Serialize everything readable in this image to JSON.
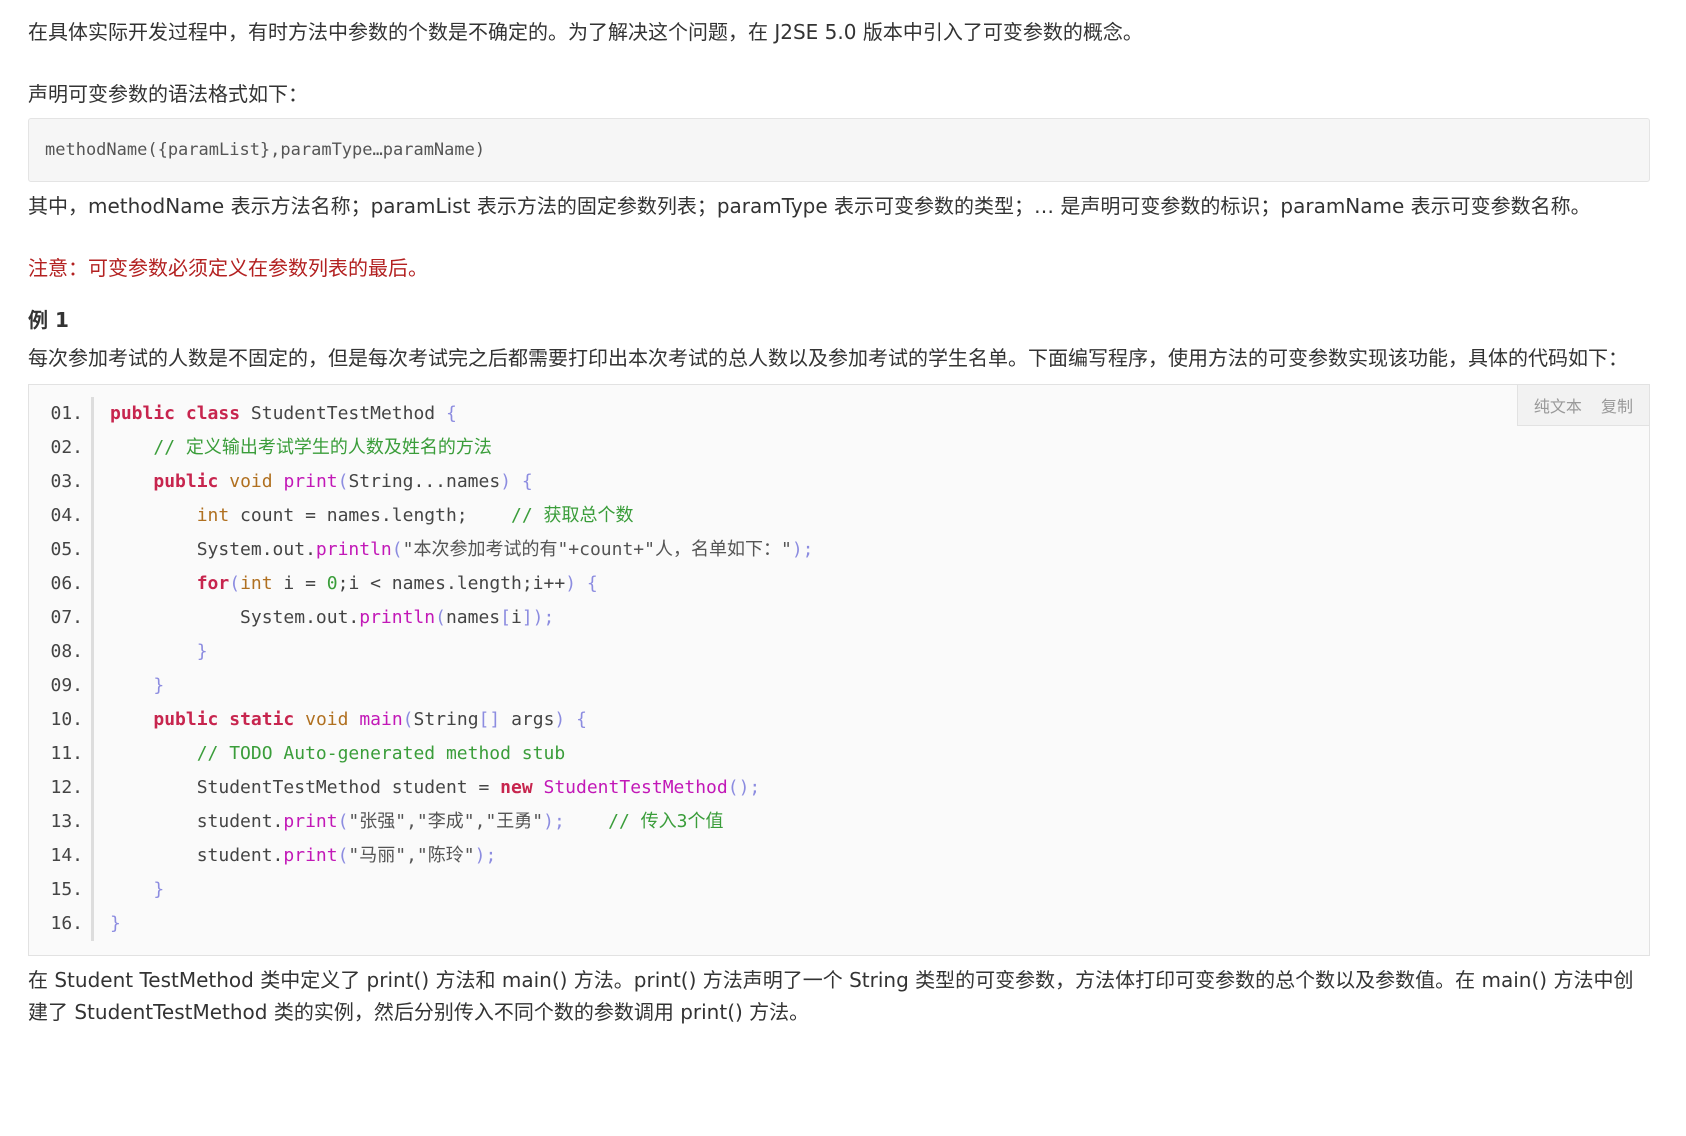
{
  "paragraphs": {
    "intro": "在具体实际开发过程中，有时方法中参数的个数是不确定的。为了解决这个问题，在 J2SE 5.0 版本中引入了可变参数的概念。",
    "syntax_intro": "声明可变参数的语法格式如下：",
    "syntax": "methodName({paramList},paramType…paramName)",
    "explain": "其中，methodName 表示方法名称；paramList 表示方法的固定参数列表；paramType 表示可变参数的类型；… 是声明可变参数的标识；paramName 表示可变参数名称。",
    "note": "注意：可变参数必须定义在参数列表的最后。",
    "example_title": "例 1",
    "example_desc": "每次参加考试的人数是不固定的，但是每次考试完之后都需要打印出本次考试的总人数以及参加考试的学生名单。下面编写程序，使用方法的可变参数实现该功能，具体的代码如下：",
    "summary": "在 Student TestMethod 类中定义了 print() 方法和 main() 方法。print() 方法声明了一个 String 类型的可变参数，方法体打印可变参数的总个数以及参数值。在 main() 方法中创建了 StudentTestMethod 类的实例，然后分别传入不同个数的参数调用 print() 方法。"
  },
  "code_tools": {
    "plain_text": "纯文本",
    "copy": "复制"
  },
  "code": {
    "line_numbers": [
      "01.",
      "02.",
      "03.",
      "04.",
      "05.",
      "06.",
      "07.",
      "08.",
      "09.",
      "10.",
      "11.",
      "12.",
      "13.",
      "14.",
      "15.",
      "16."
    ],
    "lines": [
      [
        {
          "t": "kw",
          "v": "public"
        },
        {
          "t": "",
          "v": " "
        },
        {
          "t": "kw",
          "v": "class"
        },
        {
          "t": "",
          "v": " StudentTestMethod "
        },
        {
          "t": "punc",
          "v": "{"
        }
      ],
      [
        {
          "t": "",
          "v": "    "
        },
        {
          "t": "cm",
          "v": "// 定义输出考试学生的人数及姓名的方法"
        }
      ],
      [
        {
          "t": "",
          "v": "    "
        },
        {
          "t": "kw",
          "v": "public"
        },
        {
          "t": "",
          "v": " "
        },
        {
          "t": "ty",
          "v": "void"
        },
        {
          "t": "",
          "v": " "
        },
        {
          "t": "fn",
          "v": "print"
        },
        {
          "t": "punc",
          "v": "("
        },
        {
          "t": "",
          "v": "String...names"
        },
        {
          "t": "punc",
          "v": ")"
        },
        {
          "t": "",
          "v": " "
        },
        {
          "t": "punc",
          "v": "{"
        }
      ],
      [
        {
          "t": "",
          "v": "        "
        },
        {
          "t": "ty",
          "v": "int"
        },
        {
          "t": "",
          "v": " count = names.length;    "
        },
        {
          "t": "cm",
          "v": "// 获取总个数"
        }
      ],
      [
        {
          "t": "",
          "v": "        System.out."
        },
        {
          "t": "fn",
          "v": "println"
        },
        {
          "t": "punc",
          "v": "("
        },
        {
          "t": "st",
          "v": "\"本次参加考试的有\"+count+\"人，名单如下：\""
        },
        {
          "t": "punc",
          "v": ");"
        }
      ],
      [
        {
          "t": "",
          "v": "        "
        },
        {
          "t": "kw",
          "v": "for"
        },
        {
          "t": "punc",
          "v": "("
        },
        {
          "t": "ty",
          "v": "int"
        },
        {
          "t": "",
          "v": " i = "
        },
        {
          "t": "num",
          "v": "0"
        },
        {
          "t": "",
          "v": ";i < names.length;i++"
        },
        {
          "t": "punc",
          "v": ")"
        },
        {
          "t": "",
          "v": " "
        },
        {
          "t": "punc",
          "v": "{"
        }
      ],
      [
        {
          "t": "",
          "v": "            System.out."
        },
        {
          "t": "fn",
          "v": "println"
        },
        {
          "t": "punc",
          "v": "("
        },
        {
          "t": "",
          "v": "names"
        },
        {
          "t": "punc",
          "v": "["
        },
        {
          "t": "",
          "v": "i"
        },
        {
          "t": "punc",
          "v": "]);"
        }
      ],
      [
        {
          "t": "",
          "v": "        "
        },
        {
          "t": "punc",
          "v": "}"
        }
      ],
      [
        {
          "t": "",
          "v": "    "
        },
        {
          "t": "punc",
          "v": "}"
        }
      ],
      [
        {
          "t": "",
          "v": "    "
        },
        {
          "t": "kw",
          "v": "public"
        },
        {
          "t": "",
          "v": " "
        },
        {
          "t": "kw",
          "v": "static"
        },
        {
          "t": "",
          "v": " "
        },
        {
          "t": "ty",
          "v": "void"
        },
        {
          "t": "",
          "v": " "
        },
        {
          "t": "fn",
          "v": "main"
        },
        {
          "t": "punc",
          "v": "("
        },
        {
          "t": "",
          "v": "String"
        },
        {
          "t": "punc",
          "v": "[]"
        },
        {
          "t": "",
          "v": " args"
        },
        {
          "t": "punc",
          "v": ")"
        },
        {
          "t": "",
          "v": " "
        },
        {
          "t": "punc",
          "v": "{"
        }
      ],
      [
        {
          "t": "",
          "v": "        "
        },
        {
          "t": "cm",
          "v": "// TODO Auto-generated method stub"
        }
      ],
      [
        {
          "t": "",
          "v": "        StudentTestMethod student = "
        },
        {
          "t": "kw",
          "v": "new"
        },
        {
          "t": "",
          "v": " "
        },
        {
          "t": "fn",
          "v": "StudentTestMethod"
        },
        {
          "t": "punc",
          "v": "();"
        }
      ],
      [
        {
          "t": "",
          "v": "        student."
        },
        {
          "t": "fn",
          "v": "print"
        },
        {
          "t": "punc",
          "v": "("
        },
        {
          "t": "st",
          "v": "\"张强\",\"李成\",\"王勇\""
        },
        {
          "t": "punc",
          "v": ");"
        },
        {
          "t": "",
          "v": "    "
        },
        {
          "t": "cm",
          "v": "// 传入3个值"
        }
      ],
      [
        {
          "t": "",
          "v": "        student."
        },
        {
          "t": "fn",
          "v": "print"
        },
        {
          "t": "punc",
          "v": "("
        },
        {
          "t": "st",
          "v": "\"马丽\",\"陈玲\""
        },
        {
          "t": "punc",
          "v": ");"
        }
      ],
      [
        {
          "t": "",
          "v": "    "
        },
        {
          "t": "punc",
          "v": "}"
        }
      ],
      [
        {
          "t": "punc",
          "v": "}"
        }
      ]
    ]
  }
}
